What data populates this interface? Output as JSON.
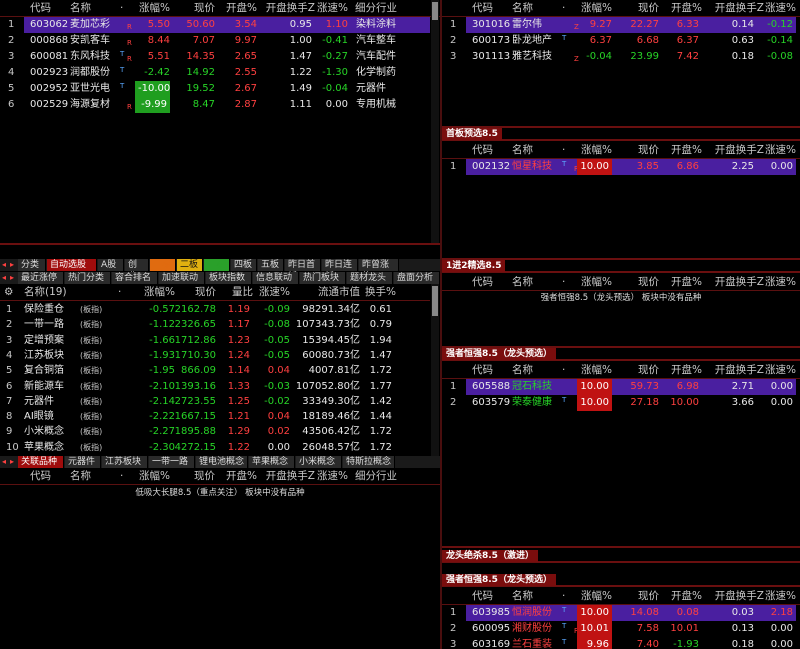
{
  "top_left": {
    "headers": [
      "代码",
      "名称",
      "·",
      "涨幅%",
      "现价",
      "开盘%",
      "开盘换手Z",
      "涨速%",
      "细分行业"
    ],
    "rows": [
      {
        "idx": "1",
        "code": "603062",
        "name": "麦加芯彩",
        "flag": "R",
        "chg": "5.50",
        "price": "50.60",
        "open": "3.54",
        "turn": "0.95",
        "speed": "1.10",
        "ind": "染料涂料",
        "t": ""
      },
      {
        "idx": "2",
        "code": "000868",
        "name": "安凯客车",
        "flag": "R",
        "chg": "8.44",
        "price": "7.07",
        "open": "9.97",
        "turn": "1.00",
        "speed": "-0.41",
        "ind": "汽车整车",
        "t": ""
      },
      {
        "idx": "3",
        "code": "600081",
        "name": "东风科技",
        "flag": "R",
        "chg": "5.51",
        "price": "14.35",
        "open": "2.65",
        "turn": "1.47",
        "speed": "-0.27",
        "ind": "汽车配件",
        "t": "T"
      },
      {
        "idx": "4",
        "code": "002923",
        "name": "润都股份",
        "flag": "",
        "chg": "-2.42",
        "price": "14.92",
        "open": "2.55",
        "turn": "1.22",
        "speed": "-1.30",
        "ind": "化学制药",
        "t": "T"
      },
      {
        "idx": "5",
        "code": "002952",
        "name": "亚世光电",
        "flag": "",
        "chg": "-10.00",
        "price": "19.52",
        "open": "2.67",
        "turn": "1.49",
        "speed": "-0.04",
        "ind": "元器件",
        "t": "T"
      },
      {
        "idx": "6",
        "code": "002529",
        "name": "海源复材",
        "flag": "R",
        "chg": "-9.99",
        "price": "8.47",
        "open": "2.87",
        "turn": "1.11",
        "speed": "0.00",
        "ind": "专用机械",
        "t": ""
      }
    ]
  },
  "tabs_row1": [
    "分类",
    "自动选股",
    "A股",
    "创业",
    "一板",
    "二板",
    "三板",
    "四板",
    "五板",
    "昨日首板",
    "昨日连板",
    "昨曾涨停"
  ],
  "tabs_row2": [
    "最近涨停",
    "热门分类",
    "容合排名",
    "加速联动",
    "板块指数",
    "信息联动",
    "热门板块",
    "题材龙头",
    "盘面分析"
  ],
  "sector": {
    "headers": [
      "名称(19)",
      "·",
      "涨幅%",
      "现价",
      "量比",
      "涨速%",
      "流通市值",
      "换手%"
    ],
    "rows": [
      {
        "idx": "1",
        "name": "保险重仓",
        "tag": "(板指)",
        "chg": "-0.57",
        "price": "2162.78",
        "vr": "1.19",
        "speed": "-0.09",
        "cap": "98291.34亿",
        "turn": "0.61"
      },
      {
        "idx": "2",
        "name": "一带一路",
        "tag": "(板指)",
        "chg": "-1.12",
        "price": "2326.65",
        "vr": "1.17",
        "speed": "-0.08",
        "cap": "107343.73亿",
        "turn": "0.79"
      },
      {
        "idx": "3",
        "name": "定增预案",
        "tag": "(板指)",
        "chg": "-1.66",
        "price": "1712.86",
        "vr": "1.23",
        "speed": "-0.05",
        "cap": "15394.45亿",
        "turn": "1.94"
      },
      {
        "idx": "4",
        "name": "江苏板块",
        "tag": "(板指)",
        "chg": "-1.93",
        "price": "1710.30",
        "vr": "1.24",
        "speed": "-0.05",
        "cap": "60080.73亿",
        "turn": "1.47"
      },
      {
        "idx": "5",
        "name": "复合铜箔",
        "tag": "(板指)",
        "chg": "-1.95",
        "price": "866.09",
        "vr": "1.14",
        "speed": "0.04",
        "cap": "4007.81亿",
        "turn": "1.72"
      },
      {
        "idx": "6",
        "name": "新能源车",
        "tag": "(板指)",
        "chg": "-2.10",
        "price": "1393.16",
        "vr": "1.33",
        "speed": "-0.03",
        "cap": "107052.80亿",
        "turn": "1.77"
      },
      {
        "idx": "7",
        "name": "元器件",
        "tag": "(板指)",
        "chg": "-2.14",
        "price": "2723.55",
        "vr": "1.25",
        "speed": "-0.02",
        "cap": "33349.30亿",
        "turn": "1.42"
      },
      {
        "idx": "8",
        "name": "AI眼镜",
        "tag": "(板指)",
        "chg": "-2.22",
        "price": "1667.15",
        "vr": "1.21",
        "speed": "0.04",
        "cap": "18189.46亿",
        "turn": "1.44"
      },
      {
        "idx": "9",
        "name": "小米概念",
        "tag": "(板指)",
        "chg": "-2.27",
        "price": "1895.88",
        "vr": "1.29",
        "speed": "0.02",
        "cap": "43506.42亿",
        "turn": "1.72"
      },
      {
        "idx": "10",
        "name": "苹果概念",
        "tag": "(板指)",
        "chg": "-2.30",
        "price": "4272.15",
        "vr": "1.22",
        "speed": "0.00",
        "cap": "26048.57亿",
        "turn": "1.72"
      }
    ]
  },
  "tabs_row3": [
    "关联品种",
    "元器件",
    "江苏板块",
    "一带一路",
    "锂电池概念",
    "苹果概念",
    "小米概念",
    "特斯拉概念"
  ],
  "bottom_left": {
    "headers": [
      "代码",
      "名称",
      "·",
      "涨幅%",
      "现价",
      "开盘%",
      "开盘换手Z",
      "涨速%",
      "细分行业"
    ],
    "empty_note": "低吸大长腿8.5（重点关注） 板块中没有品种"
  },
  "right1": {
    "headers": [
      "代码",
      "名称",
      "·",
      "涨幅%",
      "现价",
      "开盘%",
      "开盘换手Z",
      "涨速%"
    ],
    "rows": [
      {
        "idx": "1",
        "code": "301016",
        "name": "雷尔伟",
        "flag": "Z",
        "chg": "9.27",
        "price": "22.27",
        "open": "6.33",
        "turn": "0.14",
        "speed": "-0.12",
        "t": ""
      },
      {
        "idx": "2",
        "code": "600173",
        "name": "卧龙地产",
        "flag": "",
        "chg": "6.37",
        "price": "6.68",
        "open": "6.37",
        "turn": "0.63",
        "speed": "-0.14",
        "t": "T"
      },
      {
        "idx": "3",
        "code": "301113",
        "name": "雅艺科技",
        "flag": "Z",
        "chg": "-0.04",
        "price": "23.99",
        "open": "7.42",
        "turn": "0.18",
        "speed": "-0.08",
        "t": ""
      }
    ]
  },
  "right2": {
    "title": "首板预选8.5",
    "headers": [
      "代码",
      "名称",
      "·",
      "涨幅%",
      "现价",
      "开盘%",
      "开盘换手Z",
      "涨速%"
    ],
    "rows": [
      {
        "idx": "1",
        "code": "002132",
        "name": "恒星科技",
        "flag": "R",
        "chg": "10.00",
        "price": "3.85",
        "open": "6.86",
        "turn": "2.25",
        "speed": "0.00",
        "t": "T"
      }
    ]
  },
  "right3": {
    "title": "1进2精选8.5",
    "headers": [
      "代码",
      "名称",
      "·",
      "涨幅%",
      "现价",
      "开盘%",
      "开盘换手Z",
      "涨速%"
    ],
    "empty_note": "强者恒强8.5（龙头预选） 板块中没有品种"
  },
  "right4": {
    "title": "强者恒强8.5（龙头预选）",
    "headers": [
      "代码",
      "名称",
      "·",
      "涨幅%",
      "现价",
      "开盘%",
      "开盘换手Z",
      "涨速%"
    ],
    "rows": [
      {
        "idx": "1",
        "code": "605588",
        "name": "冠石科技",
        "flag": "",
        "chg": "10.00",
        "price": "59.73",
        "open": "6.98",
        "turn": "2.71",
        "speed": "0.00",
        "t": ""
      },
      {
        "idx": "2",
        "code": "603579",
        "name": "荣泰健康",
        "flag": "",
        "chg": "10.00",
        "price": "27.18",
        "open": "10.00",
        "turn": "3.66",
        "speed": "0.00",
        "t": "T"
      }
    ]
  },
  "right5": {
    "title": "龙头绝杀8.5（激进）"
  },
  "right6": {
    "title": "强者恒强8.5（龙头预选）",
    "headers": [
      "代码",
      "名称",
      "·",
      "涨幅%",
      "现价",
      "开盘%",
      "开盘换手Z",
      "涨速%"
    ],
    "rows": [
      {
        "idx": "1",
        "code": "603985",
        "name": "恒润股份",
        "flag": "",
        "chg": "10.00",
        "price": "14.08",
        "open": "0.08",
        "turn": "0.03",
        "speed": "2.18",
        "t": "T"
      },
      {
        "idx": "2",
        "code": "600095",
        "name": "湘财股份",
        "flag": "R",
        "chg": "10.01",
        "price": "7.58",
        "open": "10.01",
        "turn": "0.13",
        "speed": "0.00",
        "t": "T"
      },
      {
        "idx": "3",
        "code": "603169",
        "name": "兰石重装",
        "flag": "",
        "chg": "9.96",
        "price": "7.40",
        "open": "-1.93",
        "turn": "0.18",
        "speed": "0.00",
        "t": "T"
      }
    ]
  }
}
